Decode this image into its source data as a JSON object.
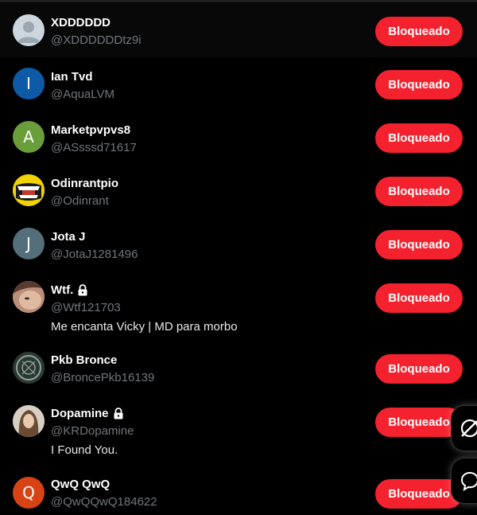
{
  "users": [
    {
      "name": "XDDDDDD",
      "handle": "@XDDDDDDtz9i",
      "button": "Bloqueado",
      "locked": false,
      "bio": "",
      "avatar_type": "default",
      "avatar_color": "#ccd6dd",
      "avatar_letter": ""
    },
    {
      "name": "Ian Tvd",
      "handle": "@AquaLVM",
      "button": "Bloqueado",
      "locked": false,
      "bio": "",
      "avatar_type": "letter",
      "avatar_color": "#0d5aa7",
      "avatar_letter": "I"
    },
    {
      "name": "Marketpvpvs8",
      "handle": "@ASsssd71617",
      "button": "Bloqueado",
      "locked": false,
      "bio": "",
      "avatar_type": "letter",
      "avatar_color": "#6a9e3b",
      "avatar_letter": "A"
    },
    {
      "name": "Odinrantpio",
      "handle": "@Odinrant",
      "button": "Bloqueado",
      "locked": false,
      "bio": "",
      "avatar_type": "image",
      "avatar_color": "#f2d200",
      "avatar_letter": ""
    },
    {
      "name": "Jota J",
      "handle": "@JotaJ1281496",
      "button": "Bloqueado",
      "locked": false,
      "bio": "",
      "avatar_type": "letter",
      "avatar_color": "#546e7a",
      "avatar_letter": "J"
    },
    {
      "name": "Wtf.",
      "handle": "@Wtf121703",
      "button": "Bloqueado",
      "locked": true,
      "bio": "Me encanta Vicky | MD para morbo",
      "avatar_type": "image",
      "avatar_color": "#c9a58c",
      "avatar_letter": ""
    },
    {
      "name": "Pkb Bronce",
      "handle": "@BroncePkb16139",
      "button": "Bloqueado",
      "locked": false,
      "bio": "",
      "avatar_type": "image",
      "avatar_color": "#3a4a44",
      "avatar_letter": ""
    },
    {
      "name": "Dopamine",
      "handle": "@KRDopamine",
      "button": "Bloqueado",
      "locked": true,
      "bio": "I Found You.",
      "avatar_type": "image",
      "avatar_color": "#b8a08a",
      "avatar_letter": ""
    },
    {
      "name": "QwQ QwQ",
      "handle": "@QwQQwQ184622",
      "button": "Bloqueado",
      "locked": false,
      "bio": "",
      "avatar_type": "letter",
      "avatar_color": "#d84315",
      "avatar_letter": "Q"
    }
  ],
  "colors": {
    "accent": "#f4212e",
    "background": "#000000",
    "muted": "#71767b"
  },
  "floating": [
    {
      "icon": "grok-icon"
    },
    {
      "icon": "chat-bubble-icon"
    }
  ]
}
